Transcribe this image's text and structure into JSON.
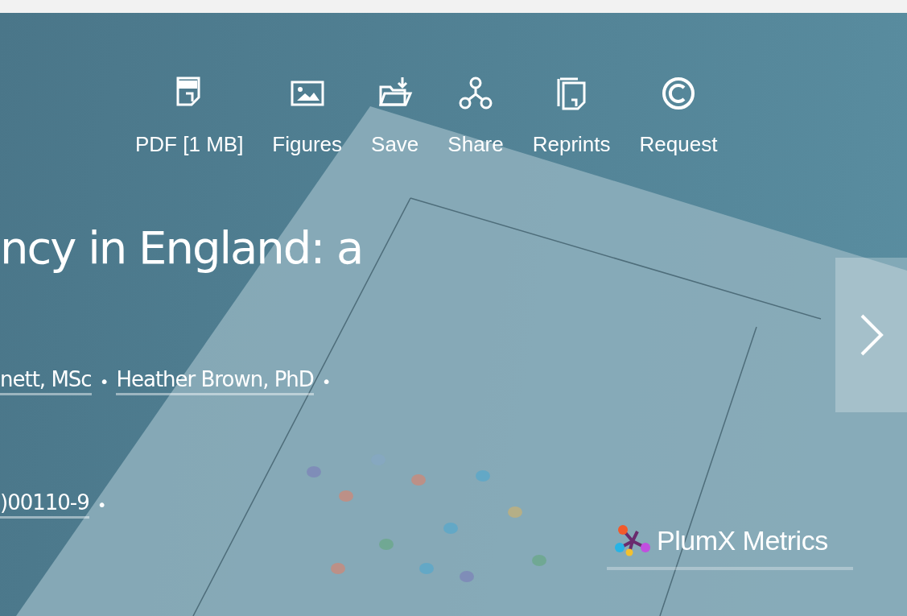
{
  "toolbar": [
    {
      "kind": "pdf",
      "label": "PDF [1 MB]"
    },
    {
      "kind": "figures",
      "label": "Figures"
    },
    {
      "kind": "save",
      "label": "Save"
    },
    {
      "kind": "share",
      "label": "Share"
    },
    {
      "kind": "reprints",
      "label": "Reprints"
    },
    {
      "kind": "request",
      "label": "Request"
    }
  ],
  "title": "ncy in England: a",
  "authors": [
    {
      "name": "nett, MSc",
      "separator": "•"
    },
    {
      "name": "Heather Brown, PhD",
      "separator": "•"
    }
  ],
  "doi": {
    "text": ")00110-9",
    "separator": "•"
  },
  "metrics": {
    "label": "PlumX Metrics"
  }
}
